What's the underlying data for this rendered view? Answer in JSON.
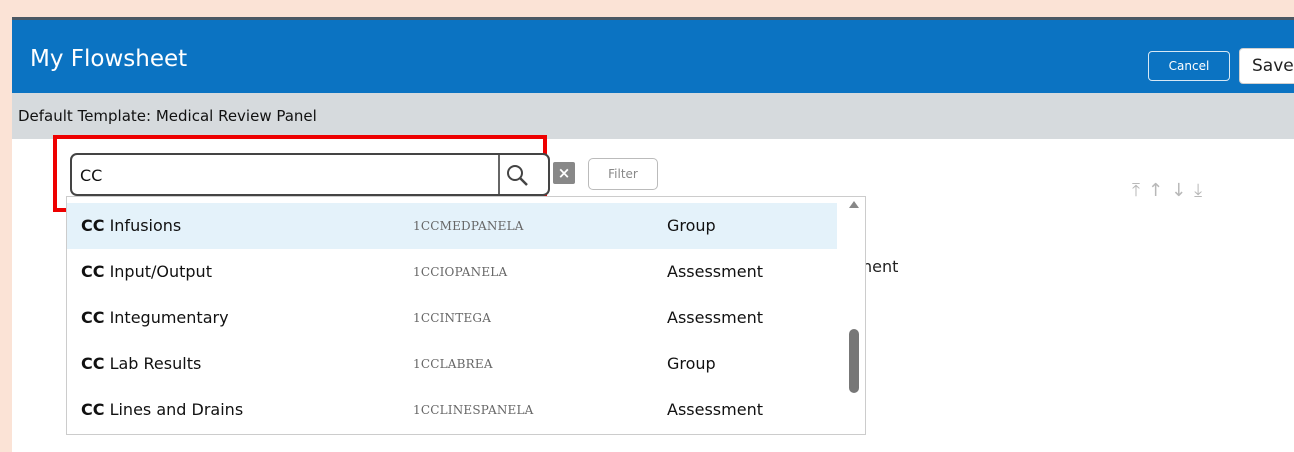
{
  "window": {
    "title": "My Flowsheet",
    "cancel_label": "Cancel",
    "save_label": "Save"
  },
  "subbar": {
    "template_text": "Default Template: Medical Review Panel"
  },
  "search": {
    "value": "CC",
    "clear_label": "×",
    "filter_label": "Filter"
  },
  "toolbar": {
    "move_icons": [
      "move-top-icon",
      "move-up-icon",
      "move-down-icon",
      "move-bottom-icon"
    ]
  },
  "background_text": "nent",
  "results": [
    {
      "prefix": "CC",
      "name": " Infusions",
      "code": "1CCMEDPANELA",
      "type": "Group",
      "selected": true
    },
    {
      "prefix": "CC",
      "name": " Input/Output",
      "code": "1CCIOPANELA",
      "type": "Assessment"
    },
    {
      "prefix": "CC",
      "name": " Integumentary",
      "code": "1CCINTEGA",
      "type": "Assessment"
    },
    {
      "prefix": "CC",
      "name": " Lab Results",
      "code": "1CCLABREA",
      "type": "Group"
    },
    {
      "prefix": "CC",
      "name": " Lines and Drains",
      "code": "1CCLINESPANELA",
      "type": "Assessment"
    }
  ],
  "colors": {
    "titlebar": "#0b73c2",
    "highlight_border": "#ee0000",
    "selected_row": "#e4f2fa"
  }
}
